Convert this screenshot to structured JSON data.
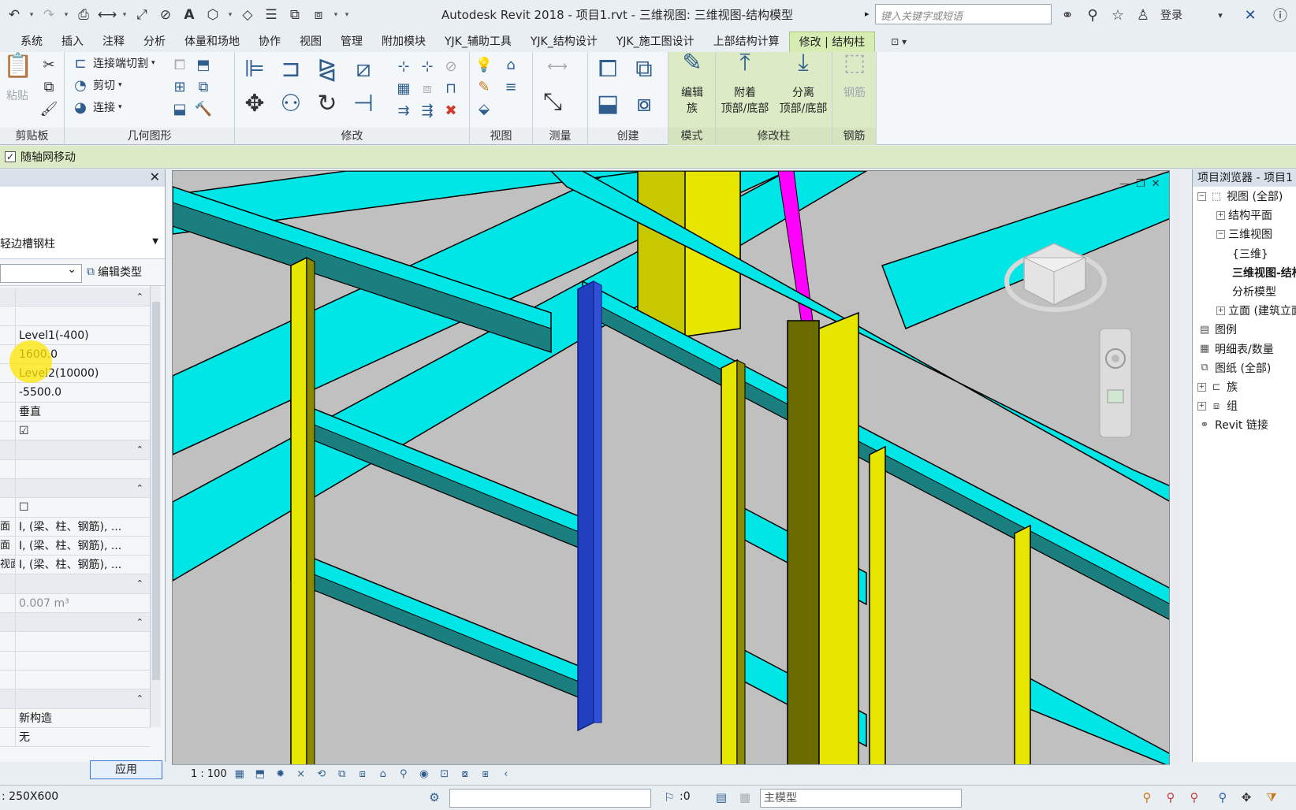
{
  "window": {
    "title": "Autodesk Revit 2018 -     项目1.rvt - 三维视图: 三维视图-结构模型",
    "search_placeholder": "键入关键字或短语",
    "login": "登录"
  },
  "tabs": [
    "系统",
    "插入",
    "注释",
    "分析",
    "体量和场地",
    "协作",
    "视图",
    "管理",
    "附加模块",
    "YJK_辅助工具",
    "YJK_结构设计",
    "YJK_施工图设计",
    "上部结构计算",
    "修改 | 结构柱"
  ],
  "ribbon": {
    "clipboard": {
      "title": "剪贴板",
      "paste": "粘贴"
    },
    "geometry": {
      "title": "几何图形",
      "join_cut": "连接端切割",
      "cut": "剪切",
      "join": "连接"
    },
    "modify": {
      "title": "修改"
    },
    "view": {
      "title": "视图"
    },
    "measure": {
      "title": "测量"
    },
    "create": {
      "title": "创建"
    },
    "mode": {
      "title": "模式",
      "edit_family_1": "编辑",
      "edit_family_2": "族"
    },
    "modify_column": {
      "title": "修改柱",
      "attach_1": "附着",
      "attach_2": "顶部/底部",
      "detach_1": "分离",
      "detach_2": "顶部/底部"
    },
    "rebar": {
      "title": "钢筋",
      "rebar_btn": "钢筋"
    }
  },
  "options_bar": {
    "move_with_grids": "随轴网移动",
    "checked": true
  },
  "properties": {
    "type_name": "轻边槽钢柱",
    "edit_type": "编辑类型",
    "rows": [
      {
        "key": "",
        "value": "",
        "section": true
      },
      {
        "key": "",
        "value": ""
      },
      {
        "key": "",
        "value": "Level1(-400)"
      },
      {
        "key": "",
        "value": "1600.0"
      },
      {
        "key": "",
        "value": "Level2(10000)"
      },
      {
        "key": "",
        "value": "-5500.0"
      },
      {
        "key": "",
        "value": "垂直"
      },
      {
        "key": "",
        "value": "☑"
      },
      {
        "key": "",
        "value": "",
        "section": true
      },
      {
        "key": "",
        "value": ""
      },
      {
        "key": "",
        "value": "",
        "section": true
      },
      {
        "key": "",
        "value": "☐"
      },
      {
        "key": "面",
        "value": "I, (梁、柱、钢筋), ..."
      },
      {
        "key": "面",
        "value": "I, (梁、柱、钢筋), ..."
      },
      {
        "key": "视面",
        "value": "I, (梁、柱、钢筋), ..."
      },
      {
        "key": "",
        "value": "",
        "section": true
      },
      {
        "key": "",
        "value": "0.007 m³",
        "muted": true
      },
      {
        "key": "",
        "value": "",
        "section": true
      },
      {
        "key": "",
        "value": ""
      },
      {
        "key": "",
        "value": ""
      },
      {
        "key": "",
        "value": ""
      },
      {
        "key": "",
        "value": "",
        "section": true
      },
      {
        "key": "",
        "value": "新构造"
      },
      {
        "key": "",
        "value": "无"
      }
    ],
    "apply": "应用"
  },
  "view_bar": {
    "scale": "1 : 100"
  },
  "browser": {
    "title": "项目浏览器 - 项目1",
    "items": [
      {
        "label": "视图 (全部)",
        "toggle": "⊟",
        "level": 0
      },
      {
        "label": "结构平面",
        "toggle": "⊞",
        "level": 1
      },
      {
        "label": "三维视图",
        "toggle": "⊟",
        "level": 1
      },
      {
        "label": "{三维}",
        "toggle": "",
        "level": 2
      },
      {
        "label": "三维视图-结构模型",
        "toggle": "",
        "level": 2,
        "bold": true
      },
      {
        "label": "分析模型",
        "toggle": "",
        "level": 2
      },
      {
        "label": "立面 (建筑立面)",
        "toggle": "⊞",
        "level": 1
      },
      {
        "label": "图例",
        "toggle": "",
        "level": 0
      },
      {
        "label": "明细表/数量",
        "toggle": "",
        "level": 0
      },
      {
        "label": "图纸 (全部)",
        "toggle": "",
        "level": 0
      },
      {
        "label": "族",
        "toggle": "⊞",
        "level": 0
      },
      {
        "label": "组",
        "toggle": "⊞",
        "level": 0
      },
      {
        "label": "Revit 链接",
        "toggle": "",
        "level": 0
      }
    ]
  },
  "status": {
    "selection": ": 250X600",
    "workset_count": ":0",
    "model": "主模型"
  },
  "colors": {
    "beam": "#00e5e5",
    "column": "#e6e600",
    "selected": "#2040c0",
    "brace": "#ff00ff",
    "ribbon_active": "#d6ecb3"
  }
}
